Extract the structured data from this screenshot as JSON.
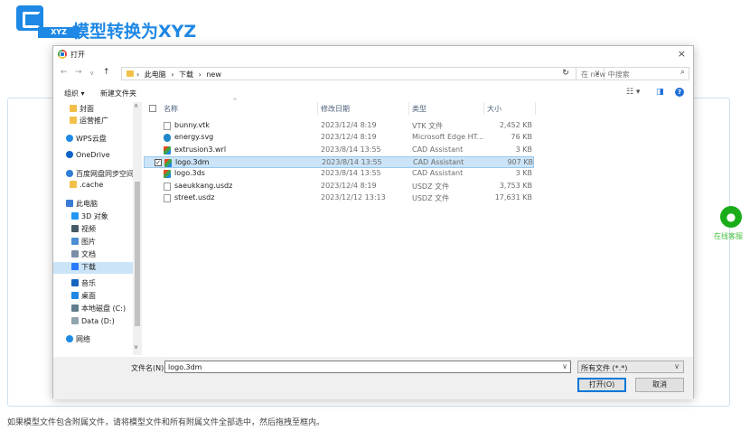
{
  "header": {
    "logo_tag": "XYZ",
    "title": "模型转换为XYZ"
  },
  "dialog": {
    "title": "打开",
    "close": "×",
    "nav": {
      "back": "←",
      "forward": "→",
      "dropdown": "∨",
      "up": "↑"
    },
    "breadcrumb": [
      "此电脑",
      "›",
      "下载",
      "›",
      "new"
    ],
    "breadcrumb_lead": "›",
    "address_dropdown": "∨",
    "refresh": "↻",
    "search_placeholder": "在 new 中搜索",
    "search_icon": "⌕",
    "toolbar": {
      "organize": "组织 ▾",
      "new_folder": "新建文件夹",
      "view_icon": "☷ ▾",
      "pane_icon": "◨",
      "help": "?"
    },
    "sidebar": [
      {
        "label": "封面",
        "icon": "folder",
        "color": "#f2c04a"
      },
      {
        "label": "运营推广",
        "icon": "folder",
        "color": "#f2c04a"
      },
      {
        "label": "WPS云盘",
        "icon": "cloud",
        "color": "#1e88e5"
      },
      {
        "label": "OneDrive",
        "icon": "cloud",
        "color": "#0a64c8"
      },
      {
        "label": "百度网盘同步空间",
        "icon": "cloud",
        "color": "#2e7dd6"
      },
      {
        "label": ".cache",
        "icon": "folder",
        "color": "#f2c04a"
      },
      {
        "label": "此电脑",
        "icon": "computer",
        "color": "#3a7bd5"
      },
      {
        "label": "3D 对象",
        "icon": "cube",
        "color": "#2196f3"
      },
      {
        "label": "视频",
        "icon": "video",
        "color": "#455a64"
      },
      {
        "label": "图片",
        "icon": "pictures",
        "color": "#4a8fd4"
      },
      {
        "label": "文档",
        "icon": "documents",
        "color": "#7a8fa6"
      },
      {
        "label": "下载",
        "icon": "download",
        "color": "#2979ff"
      },
      {
        "label": "音乐",
        "icon": "music",
        "color": "#1565c0"
      },
      {
        "label": "桌面",
        "icon": "desktop",
        "color": "#1e88e5"
      },
      {
        "label": "本地磁盘 (C:)",
        "icon": "drive",
        "color": "#607d8b"
      },
      {
        "label": "Data (D:)",
        "icon": "drive",
        "color": "#90a4ae"
      },
      {
        "label": "网络",
        "icon": "network",
        "color": "#1e88e5"
      }
    ],
    "columns": {
      "name": "名称",
      "date": "修改日期",
      "type": "类型",
      "size": "大小"
    },
    "files": [
      {
        "name": "bunny.vtk",
        "date": "2023/12/4 8:19",
        "type": "VTK 文件",
        "size": "2,452 KB",
        "icon": "doc",
        "selected": false
      },
      {
        "name": "energy.svg",
        "date": "2023/12/4 8:19",
        "type": "Microsoft Edge HT...",
        "size": "76 KB",
        "icon": "edge",
        "selected": false
      },
      {
        "name": "extrusion3.wrl",
        "date": "2023/8/14 13:55",
        "type": "CAD Assistant",
        "size": "3 KB",
        "icon": "cad",
        "selected": false
      },
      {
        "name": "logo.3dm",
        "date": "2023/8/14 13:55",
        "type": "CAD Assistant",
        "size": "907 KB",
        "icon": "cad",
        "selected": true
      },
      {
        "name": "logo.3ds",
        "date": "2023/8/14 13:55",
        "type": "CAD Assistant",
        "size": "3 KB",
        "icon": "cad",
        "selected": false
      },
      {
        "name": "saeukkang.usdz",
        "date": "2023/12/4 8:19",
        "type": "USDZ 文件",
        "size": "3,753 KB",
        "icon": "doc",
        "selected": false
      },
      {
        "name": "street.usdz",
        "date": "2023/12/12 13:13",
        "type": "USDZ 文件",
        "size": "17,631 KB",
        "icon": "doc",
        "selected": false
      }
    ],
    "filename_label": "文件名(N):",
    "filename_value": "logo.3dm",
    "filetype_value": "所有文件 (*.*)",
    "open_button": "打开(O)",
    "cancel_button": "取消",
    "checkmark": "✓"
  },
  "side_widget": {
    "label": "在线客服"
  },
  "hint": "如果模型文件包含附属文件，请将模型文件和所有附属文件全部选中，然后拖拽至框内。"
}
